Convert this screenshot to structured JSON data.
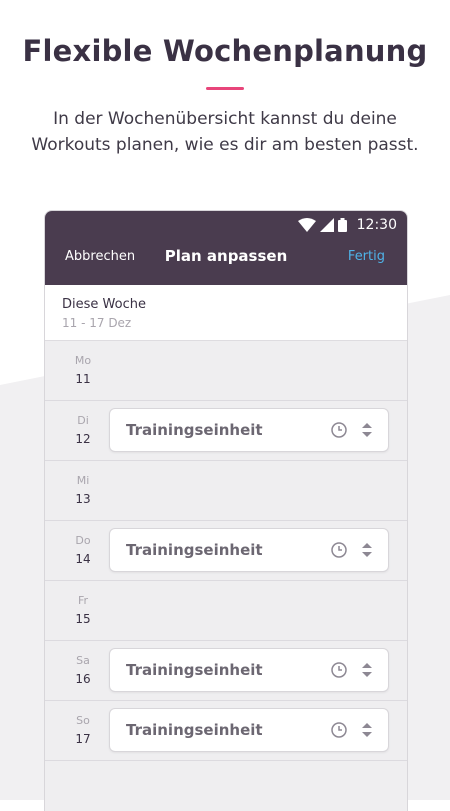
{
  "header": {
    "title": "Flexible Wochenplanung",
    "subtitle": "In der Wochenübersicht kannst du deine Workouts planen, wie es dir am besten passt."
  },
  "status_bar": {
    "time": "12:30"
  },
  "app_bar": {
    "cancel_label": "Abbrechen",
    "title": "Plan anpassen",
    "done_label": "Fertig"
  },
  "week": {
    "label": "Diese Woche",
    "range": "11 - 17 Dez"
  },
  "days": [
    {
      "name": "Mo",
      "num": "11",
      "session": ""
    },
    {
      "name": "Di",
      "num": "12",
      "session": "Trainingseinheit"
    },
    {
      "name": "Mi",
      "num": "13",
      "session": ""
    },
    {
      "name": "Do",
      "num": "14",
      "session": "Trainingseinheit"
    },
    {
      "name": "Fr",
      "num": "15",
      "session": ""
    },
    {
      "name": "Sa",
      "num": "16",
      "session": "Trainingseinheit"
    },
    {
      "name": "So",
      "num": "17",
      "session": "Trainingseinheit"
    }
  ],
  "colors": {
    "accent": "#e8457a",
    "app_bar": "#4a3c4f",
    "done": "#4fb3e8"
  },
  "icons": [
    "wifi-icon",
    "signal-icon",
    "battery-icon",
    "clock-icon",
    "sort-icon"
  ]
}
